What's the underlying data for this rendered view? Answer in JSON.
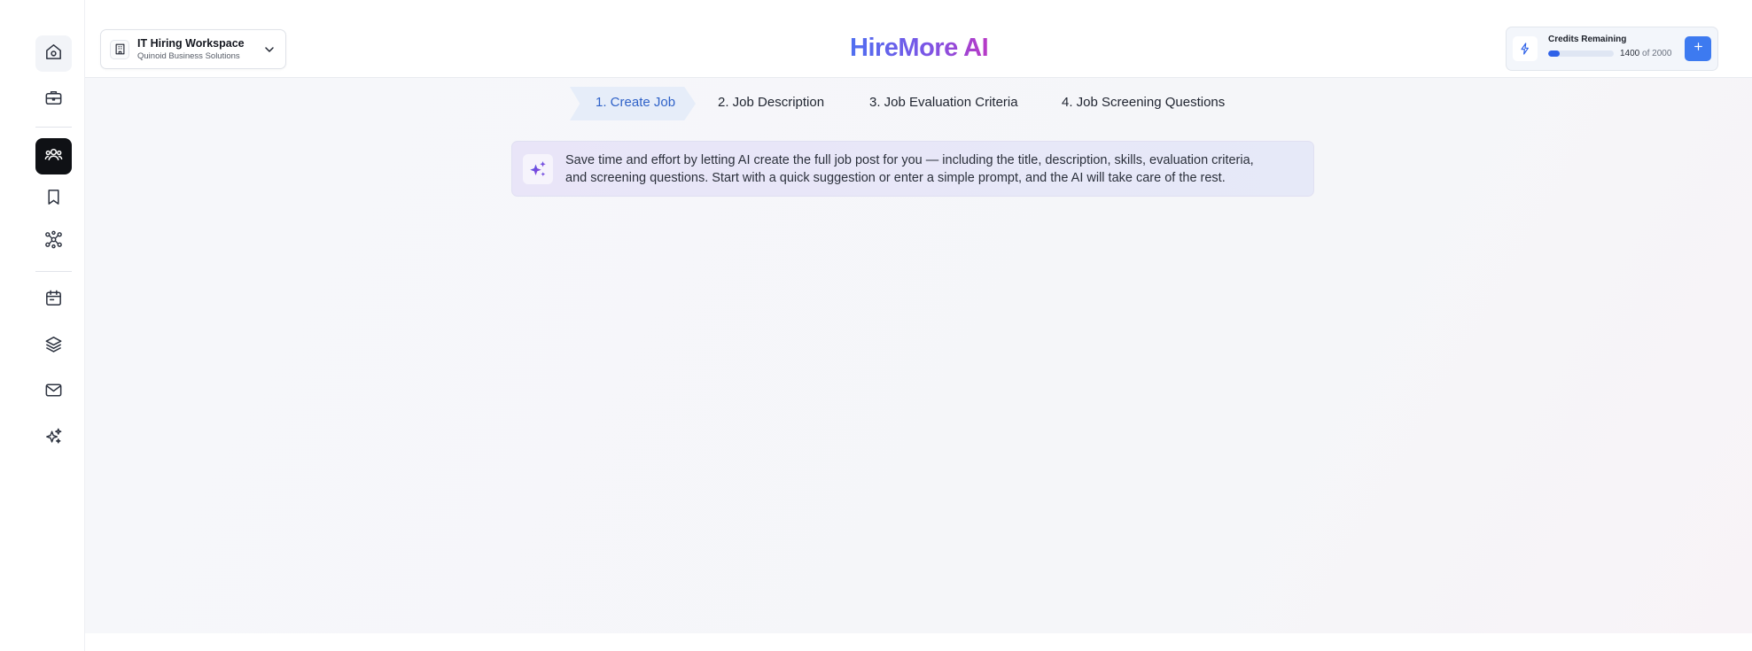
{
  "workspace": {
    "title": "IT Hiring Workspace",
    "subtitle": "Quinoid Business Solutions"
  },
  "brand": {
    "name": "HireMore AI"
  },
  "credits": {
    "label": "Credits Remaining",
    "used": "1400",
    "of": "of",
    "total": "2000",
    "fill_fraction": 0.18,
    "add_icon": "plus-icon"
  },
  "sidebar": {
    "items": [
      {
        "icon": "home-icon"
      },
      {
        "icon": "briefcase-icon"
      },
      {
        "icon": "users-group-icon",
        "active": true
      },
      {
        "icon": "bookmark-icon"
      },
      {
        "icon": "network-icon"
      },
      {
        "icon": "calendar-icon"
      },
      {
        "icon": "layers-icon"
      },
      {
        "icon": "mail-icon"
      },
      {
        "icon": "sparkles-icon"
      }
    ]
  },
  "steps": [
    {
      "label": "1. Create Job",
      "active": true
    },
    {
      "label": "2. Job Description"
    },
    {
      "label": "3. Job Evaluation Criteria"
    },
    {
      "label": "4. Job Screening Questions"
    }
  ],
  "banner": {
    "icon": "sparkles-icon",
    "line1": "Save time and effort by letting AI create the full job post for you — including the title, description, skills, evaluation criteria,",
    "line2": "and screening questions. Start with a quick suggestion or enter a simple prompt, and the AI will take care of the rest."
  },
  "colors": {
    "accent": "#2f62e8",
    "active_nav": "#0f1115",
    "step_active": "#2f62c8"
  }
}
